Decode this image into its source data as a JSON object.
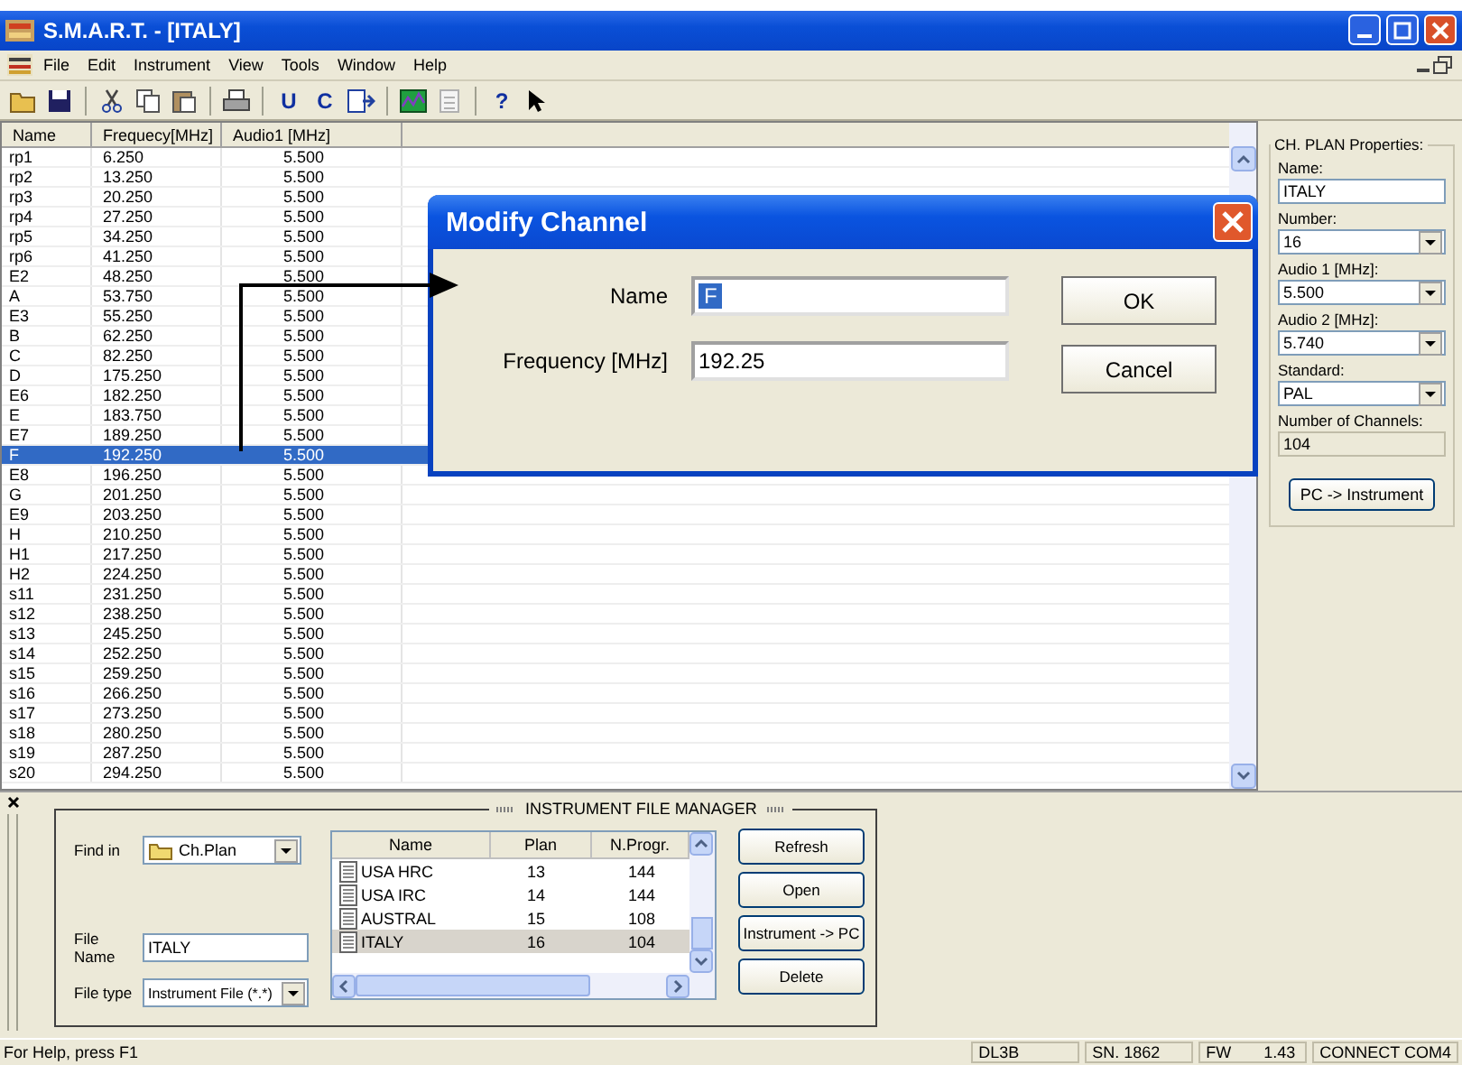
{
  "window": {
    "title": "S.M.A.R.T. - [ITALY]"
  },
  "menu": [
    "File",
    "Edit",
    "Instrument",
    "View",
    "Tools",
    "Window",
    "Help"
  ],
  "toolbar": [
    {
      "kind": "open"
    },
    {
      "kind": "save"
    },
    {
      "kind": "sep"
    },
    {
      "kind": "cut"
    },
    {
      "kind": "copy"
    },
    {
      "kind": "paste"
    },
    {
      "kind": "sep"
    },
    {
      "kind": "print"
    },
    {
      "kind": "sep"
    },
    {
      "kind": "letter",
      "label": "U"
    },
    {
      "kind": "letter",
      "label": "C"
    },
    {
      "kind": "send"
    },
    {
      "kind": "sep"
    },
    {
      "kind": "chart"
    },
    {
      "kind": "disabled"
    },
    {
      "kind": "sep"
    },
    {
      "kind": "letter",
      "label": "?"
    },
    {
      "kind": "whatsthis"
    }
  ],
  "table": {
    "columns": [
      "Name",
      "Frequecy[MHz]",
      "Audio1 [MHz]"
    ],
    "rows": [
      {
        "name": "rp1",
        "frequency": "6.250",
        "audio1": "5.500",
        "selected": false
      },
      {
        "name": "rp2",
        "frequency": "13.250",
        "audio1": "5.500",
        "selected": false
      },
      {
        "name": "rp3",
        "frequency": "20.250",
        "audio1": "5.500",
        "selected": false
      },
      {
        "name": "rp4",
        "frequency": "27.250",
        "audio1": "5.500",
        "selected": false
      },
      {
        "name": "rp5",
        "frequency": "34.250",
        "audio1": "5.500",
        "selected": false
      },
      {
        "name": "rp6",
        "frequency": "41.250",
        "audio1": "5.500",
        "selected": false
      },
      {
        "name": "E2",
        "frequency": "48.250",
        "audio1": "5.500",
        "selected": false
      },
      {
        "name": "A",
        "frequency": "53.750",
        "audio1": "5.500",
        "selected": false
      },
      {
        "name": "E3",
        "frequency": "55.250",
        "audio1": "5.500",
        "selected": false
      },
      {
        "name": "B",
        "frequency": "62.250",
        "audio1": "5.500",
        "selected": false
      },
      {
        "name": "C",
        "frequency": "82.250",
        "audio1": "5.500",
        "selected": false
      },
      {
        "name": "D",
        "frequency": "175.250",
        "audio1": "5.500",
        "selected": false
      },
      {
        "name": "E6",
        "frequency": "182.250",
        "audio1": "5.500",
        "selected": false
      },
      {
        "name": "E",
        "frequency": "183.750",
        "audio1": "5.500",
        "selected": false
      },
      {
        "name": "E7",
        "frequency": "189.250",
        "audio1": "5.500",
        "selected": false
      },
      {
        "name": "F",
        "frequency": "192.250",
        "audio1": "5.500",
        "selected": true
      },
      {
        "name": "E8",
        "frequency": "196.250",
        "audio1": "5.500",
        "selected": false
      },
      {
        "name": "G",
        "frequency": "201.250",
        "audio1": "5.500",
        "selected": false
      },
      {
        "name": "E9",
        "frequency": "203.250",
        "audio1": "5.500",
        "selected": false
      },
      {
        "name": "H",
        "frequency": "210.250",
        "audio1": "5.500",
        "selected": false
      },
      {
        "name": "H1",
        "frequency": "217.250",
        "audio1": "5.500",
        "selected": false
      },
      {
        "name": "H2",
        "frequency": "224.250",
        "audio1": "5.500",
        "selected": false
      },
      {
        "name": "s11",
        "frequency": "231.250",
        "audio1": "5.500",
        "selected": false
      },
      {
        "name": "s12",
        "frequency": "238.250",
        "audio1": "5.500",
        "selected": false
      },
      {
        "name": "s13",
        "frequency": "245.250",
        "audio1": "5.500",
        "selected": false
      },
      {
        "name": "s14",
        "frequency": "252.250",
        "audio1": "5.500",
        "selected": false
      },
      {
        "name": "s15",
        "frequency": "259.250",
        "audio1": "5.500",
        "selected": false
      },
      {
        "name": "s16",
        "frequency": "266.250",
        "audio1": "5.500",
        "selected": false
      },
      {
        "name": "s17",
        "frequency": "273.250",
        "audio1": "5.500",
        "selected": false
      },
      {
        "name": "s18",
        "frequency": "280.250",
        "audio1": "5.500",
        "selected": false
      },
      {
        "name": "s19",
        "frequency": "287.250",
        "audio1": "5.500",
        "selected": false
      },
      {
        "name": "s20",
        "frequency": "294.250",
        "audio1": "5.500",
        "selected": false
      }
    ]
  },
  "dialog": {
    "title": "Modify Channel",
    "fields": [
      {
        "label": "Name",
        "value": "F",
        "text_selected": true
      },
      {
        "label": "Frequency [MHz]",
        "value": "192.25",
        "text_selected": false
      }
    ],
    "buttons": [
      "OK",
      "Cancel"
    ]
  },
  "properties": {
    "title": "CH. PLAN Properties:",
    "fields": [
      {
        "label": "Name:",
        "value": "ITALY",
        "kind": "text"
      },
      {
        "label": "Number:",
        "value": "16",
        "kind": "combo"
      },
      {
        "label": "Audio 1 [MHz]:",
        "value": "5.500",
        "kind": "combo"
      },
      {
        "label": "Audio 2 [MHz]:",
        "value": "5.740",
        "kind": "combo"
      },
      {
        "label": "Standard:",
        "value": "PAL",
        "kind": "combo"
      },
      {
        "label": "Number of Channels:",
        "value": "104",
        "kind": "readonly"
      }
    ],
    "button": "PC -> Instrument"
  },
  "file_manager": {
    "title": "INSTRUMENT FILE MANAGER",
    "find_in": {
      "label": "Find in",
      "value": "Ch.Plan"
    },
    "file_name": {
      "label": "File Name",
      "value": "ITALY"
    },
    "file_type": {
      "label": "File type",
      "value": "Instrument File (*.*)"
    },
    "list": {
      "columns": [
        "Name",
        "Plan",
        "N.Progr."
      ],
      "rows": [
        {
          "name": "USA HRC",
          "plan": "13",
          "progr": "144",
          "selected": false
        },
        {
          "name": "USA IRC",
          "plan": "14",
          "progr": "144",
          "selected": false
        },
        {
          "name": "AUSTRAL",
          "plan": "15",
          "progr": "108",
          "selected": false
        },
        {
          "name": "ITALY",
          "plan": "16",
          "progr": "104",
          "selected": true
        }
      ]
    },
    "buttons": [
      "Refresh",
      "Open",
      "Instrument -> PC",
      "Delete"
    ]
  },
  "status_bar": {
    "help": "For Help, press F1",
    "panes": [
      [
        "DL3B"
      ],
      [
        "SN. 1862"
      ],
      [
        "FW",
        "1.43"
      ],
      [
        "CONNECT COM4"
      ]
    ]
  }
}
